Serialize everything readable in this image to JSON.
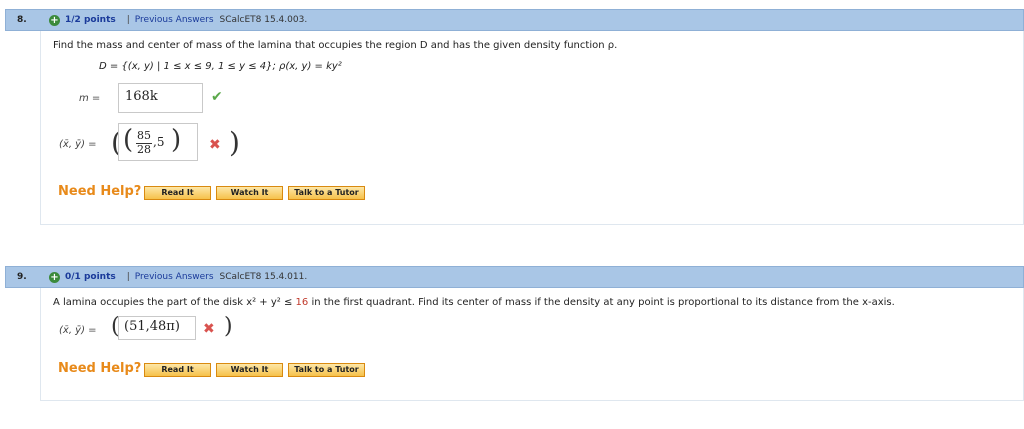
{
  "q8": {
    "number": "8.",
    "points": "1/2 points",
    "separator": "|",
    "previous_answers": "Previous Answers",
    "reference": "SCalcET8 15.4.003.",
    "statement": "Find the mass and center of mass of the lamina that occupies the region D and has the given density function ρ.",
    "region_def": "D = {(x, y) | 1 ≤ x ≤ 9, 1 ≤ y ≤ 4}; ρ(x, y) = ky²",
    "mass_label": "m =",
    "mass_answer": "168k",
    "com_label": "(x̄, ȳ) =",
    "com_frac_num": "85",
    "com_frac_den": "28",
    "com_second": ",5"
  },
  "q9": {
    "number": "9.",
    "points": "0/1 points",
    "separator": "|",
    "previous_answers": "Previous Answers",
    "reference": "SCalcET8 15.4.011.",
    "statement_pre": "A lamina occupies the part of the disk x² + y² ≤ ",
    "statement_num": "16",
    "statement_post": " in the first quadrant. Find its center of mass if the density at any point is proportional to its distance from the x-axis.",
    "com_label": "(x̄, ȳ) =",
    "com_answer": "(51,48π)"
  },
  "help": {
    "need_help": "Need Help?",
    "read_it": "Read It",
    "watch_it": "Watch It",
    "talk_tutor": "Talk to a Tutor"
  }
}
